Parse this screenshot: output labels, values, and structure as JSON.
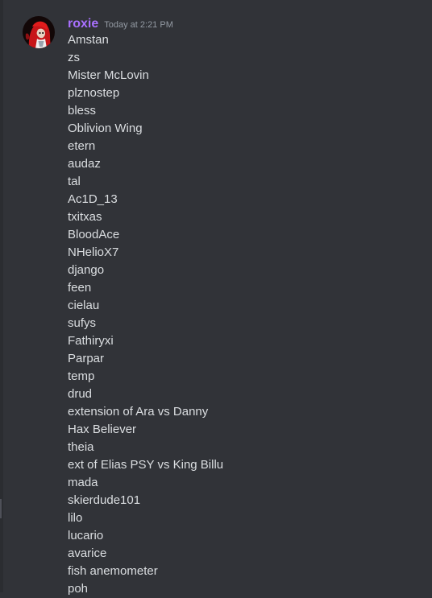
{
  "message": {
    "author": "roxie",
    "timestamp": "Today at 2:21 PM",
    "avatar_icon": "user-avatar-icon",
    "lines": [
      "Amstan",
      "zs",
      "Mister McLovin",
      "plznostep",
      "bless",
      "Oblivion Wing",
      "etern",
      "audaz",
      "tal",
      "Ac1D_13",
      "txitxas",
      "BloodAce",
      "NHelioX7",
      "django",
      "feen",
      "cielau",
      "sufys",
      "Fathiryxi",
      "Parpar",
      "temp",
      "drud",
      "extension of Ara vs Danny",
      "Hax Believer",
      "theia",
      "ext of Elias PSY vs King Billu",
      "mada",
      "skierdude101",
      "lilo",
      "lucario",
      "avarice",
      "fish anemometer",
      "poh"
    ]
  },
  "colors": {
    "background": "#313338",
    "username": "#a970ff",
    "text": "#dbdee1",
    "timestamp": "#949ba4"
  }
}
